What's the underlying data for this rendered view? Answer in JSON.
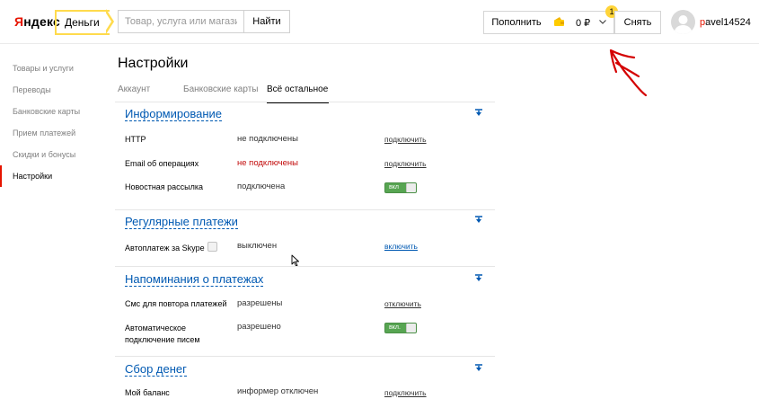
{
  "header": {
    "logo_first": "Я",
    "logo_rest": "ндекс",
    "service_tab": "Деньги",
    "search": {
      "placeholder": "Товар, услуга или магазин"
    },
    "search_button": "Найти",
    "topup_button": "Пополнить",
    "balance": "0 ₽",
    "notification_count": "1",
    "withdraw_button": "Снять",
    "user": {
      "first": "p",
      "rest": "avel14524"
    }
  },
  "sidebar": {
    "items": [
      {
        "label": "Товары и услуги"
      },
      {
        "label": "Переводы"
      },
      {
        "label": "Банковские карты"
      },
      {
        "label": "Прием платежей"
      },
      {
        "label": "Скидки и бонусы"
      },
      {
        "label": "Настройки"
      }
    ]
  },
  "page": {
    "title": "Настройки",
    "tabs": [
      {
        "label": "Аккаунт"
      },
      {
        "label": "Банковские карты"
      },
      {
        "label": "Всё остальное"
      }
    ]
  },
  "sections": {
    "informing": {
      "title": "Информирование",
      "rows": [
        {
          "label": "HTTP",
          "value": "не подключены",
          "action": "подключить"
        },
        {
          "label": "Email об операциях",
          "value": "не подключены",
          "action": "подключить"
        },
        {
          "label": "Новостная рассылка",
          "value": "подключена",
          "toggle": "вкл"
        }
      ]
    },
    "regular": {
      "title": "Регулярные платежи",
      "rows": [
        {
          "label": "Автоплатеж за Skype",
          "value": "выключен",
          "action": "включить"
        }
      ]
    },
    "reminders": {
      "title": "Напоминания о платежах",
      "rows": [
        {
          "label": "Смс для повтора платежей",
          "value": "разрешены",
          "action": "отключить"
        },
        {
          "label_line1": "Автоматическое",
          "label_line2": "подключение писем",
          "value": "разрешено",
          "toggle": "вкл."
        }
      ]
    },
    "fundraising": {
      "title": "Сбор денег",
      "rows": [
        {
          "label": "Мой баланс",
          "value": "информер отключен",
          "action": "подключить"
        }
      ]
    }
  },
  "colors": {
    "brand_red": "#e61400",
    "accent_yellow": "#ffdb4d",
    "link_blue": "#0059b2",
    "toggle_green": "#57a552",
    "annotation_red": "#d40000"
  }
}
